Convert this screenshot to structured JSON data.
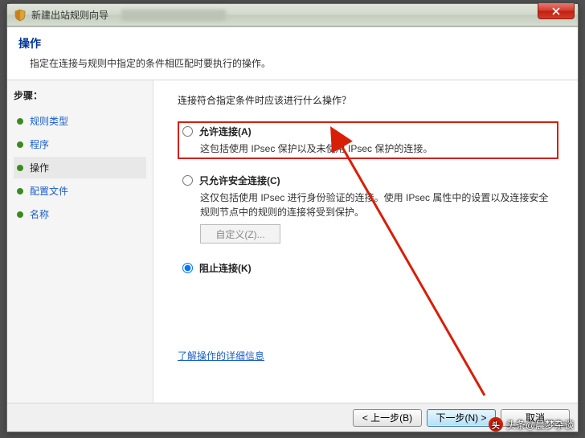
{
  "titlebar": {
    "title": "新建出站规则向导"
  },
  "header": {
    "title": "操作",
    "subtitle": "指定在连接与规则中指定的条件相匹配时要执行的操作。"
  },
  "sidebar": {
    "title": "步骤：",
    "steps": [
      {
        "label": "规则类型"
      },
      {
        "label": "程序"
      },
      {
        "label": "操作"
      },
      {
        "label": "配置文件"
      },
      {
        "label": "名称"
      }
    ]
  },
  "main": {
    "question": "连接符合指定条件时应该进行什么操作？",
    "options": {
      "allow": {
        "title": "允许连接(A)",
        "desc": "这包括使用 IPsec 保护以及未使用 IPsec 保护的连接。"
      },
      "secure": {
        "title": "只允许安全连接(C)",
        "desc": "这仅包括使用 IPsec 进行身份验证的连接。使用 IPsec 属性中的设置以及连接安全规则节点中的规则的连接将受到保护。",
        "customize_btn": "自定义(Z)..."
      },
      "block": {
        "title": "阻止连接(K)"
      }
    },
    "learn_more": "了解操作的详细信息"
  },
  "footer": {
    "back": "< 上一步(B)",
    "next": "下一步(N) >",
    "cancel": "取消"
  },
  "watermark": {
    "text": "头条@晨梦杂谈"
  },
  "colors": {
    "highlight": "#d81e06",
    "link": "#1a5dc7"
  }
}
